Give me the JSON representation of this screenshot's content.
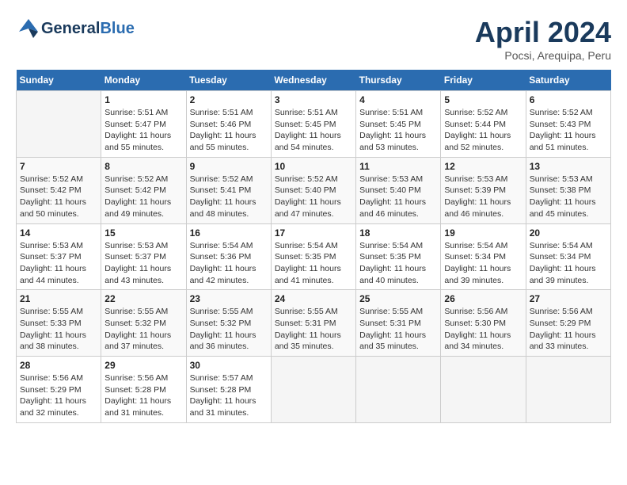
{
  "header": {
    "logo_general": "General",
    "logo_blue": "Blue",
    "title": "April 2024",
    "location": "Pocsi, Arequipa, Peru"
  },
  "calendar": {
    "days_of_week": [
      "Sunday",
      "Monday",
      "Tuesday",
      "Wednesday",
      "Thursday",
      "Friday",
      "Saturday"
    ],
    "weeks": [
      [
        {
          "day": "",
          "sunrise": "",
          "sunset": "",
          "daylight": ""
        },
        {
          "day": "1",
          "sunrise": "Sunrise: 5:51 AM",
          "sunset": "Sunset: 5:47 PM",
          "daylight": "Daylight: 11 hours and 55 minutes."
        },
        {
          "day": "2",
          "sunrise": "Sunrise: 5:51 AM",
          "sunset": "Sunset: 5:46 PM",
          "daylight": "Daylight: 11 hours and 55 minutes."
        },
        {
          "day": "3",
          "sunrise": "Sunrise: 5:51 AM",
          "sunset": "Sunset: 5:45 PM",
          "daylight": "Daylight: 11 hours and 54 minutes."
        },
        {
          "day": "4",
          "sunrise": "Sunrise: 5:51 AM",
          "sunset": "Sunset: 5:45 PM",
          "daylight": "Daylight: 11 hours and 53 minutes."
        },
        {
          "day": "5",
          "sunrise": "Sunrise: 5:52 AM",
          "sunset": "Sunset: 5:44 PM",
          "daylight": "Daylight: 11 hours and 52 minutes."
        },
        {
          "day": "6",
          "sunrise": "Sunrise: 5:52 AM",
          "sunset": "Sunset: 5:43 PM",
          "daylight": "Daylight: 11 hours and 51 minutes."
        }
      ],
      [
        {
          "day": "7",
          "sunrise": "Sunrise: 5:52 AM",
          "sunset": "Sunset: 5:42 PM",
          "daylight": "Daylight: 11 hours and 50 minutes."
        },
        {
          "day": "8",
          "sunrise": "Sunrise: 5:52 AM",
          "sunset": "Sunset: 5:42 PM",
          "daylight": "Daylight: 11 hours and 49 minutes."
        },
        {
          "day": "9",
          "sunrise": "Sunrise: 5:52 AM",
          "sunset": "Sunset: 5:41 PM",
          "daylight": "Daylight: 11 hours and 48 minutes."
        },
        {
          "day": "10",
          "sunrise": "Sunrise: 5:52 AM",
          "sunset": "Sunset: 5:40 PM",
          "daylight": "Daylight: 11 hours and 47 minutes."
        },
        {
          "day": "11",
          "sunrise": "Sunrise: 5:53 AM",
          "sunset": "Sunset: 5:40 PM",
          "daylight": "Daylight: 11 hours and 46 minutes."
        },
        {
          "day": "12",
          "sunrise": "Sunrise: 5:53 AM",
          "sunset": "Sunset: 5:39 PM",
          "daylight": "Daylight: 11 hours and 46 minutes."
        },
        {
          "day": "13",
          "sunrise": "Sunrise: 5:53 AM",
          "sunset": "Sunset: 5:38 PM",
          "daylight": "Daylight: 11 hours and 45 minutes."
        }
      ],
      [
        {
          "day": "14",
          "sunrise": "Sunrise: 5:53 AM",
          "sunset": "Sunset: 5:37 PM",
          "daylight": "Daylight: 11 hours and 44 minutes."
        },
        {
          "day": "15",
          "sunrise": "Sunrise: 5:53 AM",
          "sunset": "Sunset: 5:37 PM",
          "daylight": "Daylight: 11 hours and 43 minutes."
        },
        {
          "day": "16",
          "sunrise": "Sunrise: 5:54 AM",
          "sunset": "Sunset: 5:36 PM",
          "daylight": "Daylight: 11 hours and 42 minutes."
        },
        {
          "day": "17",
          "sunrise": "Sunrise: 5:54 AM",
          "sunset": "Sunset: 5:35 PM",
          "daylight": "Daylight: 11 hours and 41 minutes."
        },
        {
          "day": "18",
          "sunrise": "Sunrise: 5:54 AM",
          "sunset": "Sunset: 5:35 PM",
          "daylight": "Daylight: 11 hours and 40 minutes."
        },
        {
          "day": "19",
          "sunrise": "Sunrise: 5:54 AM",
          "sunset": "Sunset: 5:34 PM",
          "daylight": "Daylight: 11 hours and 39 minutes."
        },
        {
          "day": "20",
          "sunrise": "Sunrise: 5:54 AM",
          "sunset": "Sunset: 5:34 PM",
          "daylight": "Daylight: 11 hours and 39 minutes."
        }
      ],
      [
        {
          "day": "21",
          "sunrise": "Sunrise: 5:55 AM",
          "sunset": "Sunset: 5:33 PM",
          "daylight": "Daylight: 11 hours and 38 minutes."
        },
        {
          "day": "22",
          "sunrise": "Sunrise: 5:55 AM",
          "sunset": "Sunset: 5:32 PM",
          "daylight": "Daylight: 11 hours and 37 minutes."
        },
        {
          "day": "23",
          "sunrise": "Sunrise: 5:55 AM",
          "sunset": "Sunset: 5:32 PM",
          "daylight": "Daylight: 11 hours and 36 minutes."
        },
        {
          "day": "24",
          "sunrise": "Sunrise: 5:55 AM",
          "sunset": "Sunset: 5:31 PM",
          "daylight": "Daylight: 11 hours and 35 minutes."
        },
        {
          "day": "25",
          "sunrise": "Sunrise: 5:55 AM",
          "sunset": "Sunset: 5:31 PM",
          "daylight": "Daylight: 11 hours and 35 minutes."
        },
        {
          "day": "26",
          "sunrise": "Sunrise: 5:56 AM",
          "sunset": "Sunset: 5:30 PM",
          "daylight": "Daylight: 11 hours and 34 minutes."
        },
        {
          "day": "27",
          "sunrise": "Sunrise: 5:56 AM",
          "sunset": "Sunset: 5:29 PM",
          "daylight": "Daylight: 11 hours and 33 minutes."
        }
      ],
      [
        {
          "day": "28",
          "sunrise": "Sunrise: 5:56 AM",
          "sunset": "Sunset: 5:29 PM",
          "daylight": "Daylight: 11 hours and 32 minutes."
        },
        {
          "day": "29",
          "sunrise": "Sunrise: 5:56 AM",
          "sunset": "Sunset: 5:28 PM",
          "daylight": "Daylight: 11 hours and 31 minutes."
        },
        {
          "day": "30",
          "sunrise": "Sunrise: 5:57 AM",
          "sunset": "Sunset: 5:28 PM",
          "daylight": "Daylight: 11 hours and 31 minutes."
        },
        {
          "day": "",
          "sunrise": "",
          "sunset": "",
          "daylight": ""
        },
        {
          "day": "",
          "sunrise": "",
          "sunset": "",
          "daylight": ""
        },
        {
          "day": "",
          "sunrise": "",
          "sunset": "",
          "daylight": ""
        },
        {
          "day": "",
          "sunrise": "",
          "sunset": "",
          "daylight": ""
        }
      ]
    ]
  }
}
